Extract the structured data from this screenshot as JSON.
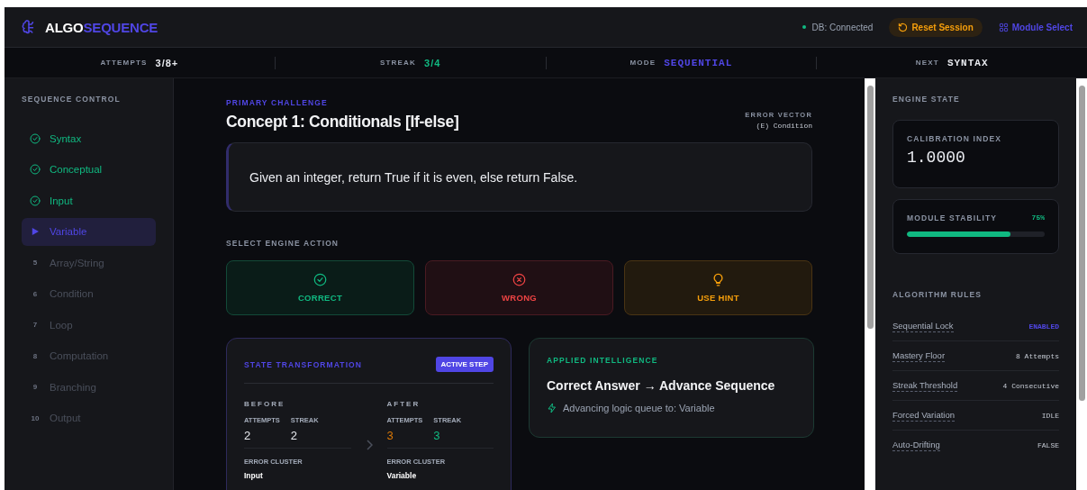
{
  "header": {
    "logo_prefix": "ALGO",
    "logo_suffix": "SEQUENCE",
    "db_status": "DB: Connected",
    "connected": true,
    "reset_button": "Reset Session",
    "module_button": "Module Select"
  },
  "stats": [
    {
      "label": "ATTEMPTS",
      "value": "3/8+",
      "color": "#e8eaef",
      "kind": "count"
    },
    {
      "label": "STREAK",
      "value": "3/4",
      "color": "#10b981",
      "kind": "count"
    },
    {
      "label": "MODE",
      "value": "SEQUENTIAL",
      "color": "#5046e5",
      "kind": "code"
    },
    {
      "label": "NEXT",
      "value": "SYNTAX",
      "color": "#e8eaef",
      "kind": "code"
    }
  ],
  "sidebar": {
    "title": "SEQUENCE CONTROL",
    "items": [
      {
        "label": "Syntax",
        "kind": "done",
        "selected": false
      },
      {
        "label": "Conceptual",
        "kind": "done",
        "selected": false
      },
      {
        "label": "Input",
        "kind": "done",
        "selected": false
      },
      {
        "label": "Variable",
        "kind": "current",
        "selected": true
      },
      {
        "label": "Array/String",
        "kind": "locked",
        "number": "5",
        "selected": false
      },
      {
        "label": "Condition",
        "kind": "locked",
        "number": "6",
        "selected": false
      },
      {
        "label": "Loop",
        "kind": "locked",
        "number": "7",
        "selected": false
      },
      {
        "label": "Computation",
        "kind": "locked",
        "number": "8",
        "selected": false
      },
      {
        "label": "Branching",
        "kind": "locked",
        "number": "9",
        "selected": false
      },
      {
        "label": "Output",
        "kind": "locked",
        "number": "10",
        "selected": false
      }
    ]
  },
  "challenge": {
    "eyebrow": "PRIMARY CHALLENGE",
    "title": "Concept 1: Conditionals [If-else]",
    "error_vector_label": "ERROR VECTOR",
    "error_vector_value": "(E) Condition",
    "prompt": "Given an integer, return True if it is even, else return False."
  },
  "actions": {
    "title": "SELECT ENGINE ACTION",
    "buttons": [
      {
        "label": "CORRECT",
        "kind": "correct"
      },
      {
        "label": "WRONG",
        "kind": "wrong"
      },
      {
        "label": "USE HINT",
        "kind": "hint"
      }
    ]
  },
  "transformation": {
    "title": "STATE TRANSFORMATION",
    "badge": "ACTIVE STEP",
    "columns": [
      {
        "heading": "BEFORE",
        "metrics": [
          {
            "label": "ATTEMPTS",
            "value": "2",
            "color": "#e8eaef"
          },
          {
            "label": "STREAK",
            "value": "2",
            "color": "#e8eaef"
          }
        ],
        "cluster_label": "ERROR CLUSTER",
        "cluster": "Input"
      },
      {
        "heading": "AFTER",
        "metrics": [
          {
            "label": "ATTEMPTS",
            "value": "3",
            "color": "#d97706"
          },
          {
            "label": "STREAK",
            "value": "3",
            "color": "#10b981"
          }
        ],
        "cluster_label": "ERROR CLUSTER",
        "cluster": "Variable"
      }
    ]
  },
  "intelligence": {
    "eyebrow": "APPLIED INTELLIGENCE",
    "title": "Correct Answer → Advance Sequence",
    "detail": "Advancing logic queue to: Variable"
  },
  "engine": {
    "title": "ENGINE STATE",
    "calibration_label": "CALIBRATION INDEX",
    "calibration_value": "1.0000",
    "stability_label": "MODULE STABILITY",
    "stability_reading": "75%",
    "level": 0.75
  },
  "rules": {
    "title": "ALGORITHM RULES",
    "items": [
      {
        "label": "Sequential Lock",
        "value": "ENABLED",
        "highlighted": true
      },
      {
        "label": "Mastery Floor",
        "value": "8 Attempts",
        "highlighted": false
      },
      {
        "label": "Streak Threshold",
        "value": "4 Consecutive",
        "highlighted": false
      },
      {
        "label": "Forced Variation",
        "value": "IDLE",
        "highlighted": false
      },
      {
        "label": "Auto-Drifting",
        "value": "FALSE",
        "highlighted": false
      }
    ]
  }
}
